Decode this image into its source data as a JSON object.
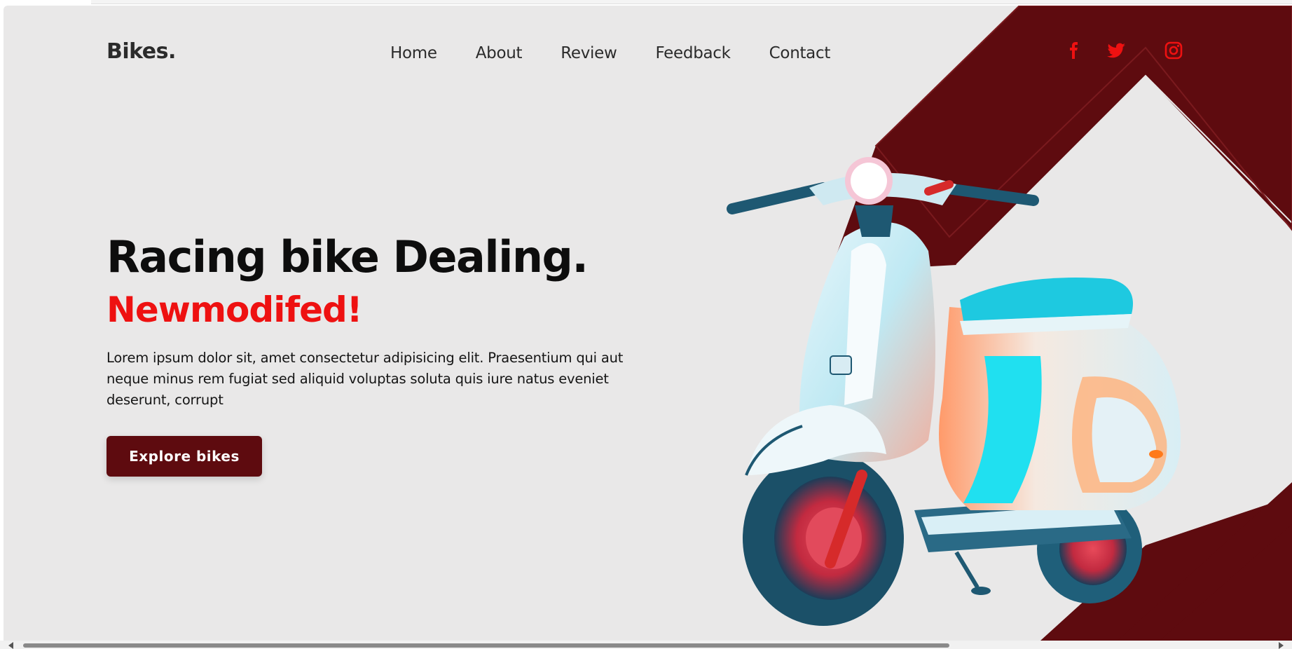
{
  "header": {
    "brand": "Bikes.",
    "nav": [
      "Home",
      "About",
      "Review",
      "Feedback",
      "Contact"
    ],
    "social_icons": [
      "facebook-icon",
      "twitter-icon",
      "instagram-icon"
    ]
  },
  "hero": {
    "title": "Racing bike Dealing.",
    "subtitle": "Newmodifed!",
    "description": "Lorem ipsum dolor sit, amet consectetur adipisicing elit. Praesentium qui aut neque minus rem fugiat sed aliquid voluptas soluta quis iure natus eveniet deserunt, corrupt",
    "cta_label": "Explore bikes",
    "image": "scooter-illustration"
  },
  "colors": {
    "background": "#e9e8e8",
    "accent_dark_red": "#5e0b0f",
    "accent_red": "#ee1111",
    "text_dark": "#0d0d0d"
  }
}
